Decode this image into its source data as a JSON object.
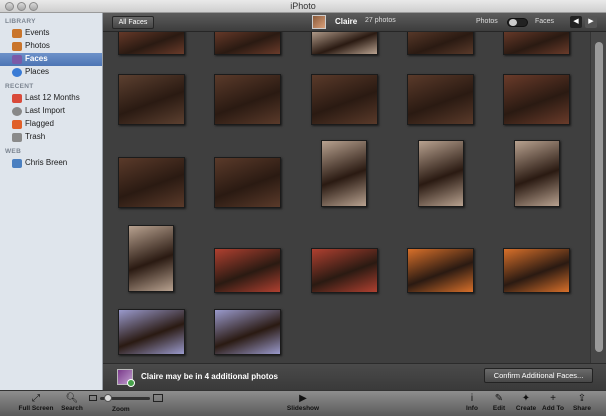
{
  "window": {
    "title": "iPhoto"
  },
  "sidebar": {
    "sections": [
      {
        "heading": "LIBRARY",
        "items": [
          {
            "label": "Events",
            "icon": "events-icon",
            "color": "#c9742a"
          },
          {
            "label": "Photos",
            "icon": "photos-icon",
            "color": "#c9742a"
          },
          {
            "label": "Faces",
            "icon": "faces-icon",
            "color": "#7b5aa8",
            "selected": true
          },
          {
            "label": "Places",
            "icon": "places-icon",
            "color": "#3a7bd5"
          }
        ]
      },
      {
        "heading": "RECENT",
        "items": [
          {
            "label": "Last 12 Months",
            "icon": "calendar-icon",
            "color": "#d94a3a"
          },
          {
            "label": "Last Import",
            "icon": "clock-icon",
            "color": "#888888"
          },
          {
            "label": "Flagged",
            "icon": "flag-icon",
            "color": "#e0602a"
          },
          {
            "label": "Trash",
            "icon": "trash-icon",
            "color": "#8a8a8a"
          }
        ]
      },
      {
        "heading": "WEB",
        "items": [
          {
            "label": "Chris Breen",
            "icon": "web-album-icon",
            "color": "#4a7fc0"
          }
        ]
      }
    ]
  },
  "header": {
    "all_faces_button": "All Faces",
    "face_name": "Claire",
    "photo_count": "27 photos",
    "toggle_left_label": "Photos",
    "toggle_right_label": "Faces",
    "back_glyph": "◀",
    "forward_glyph": "▶"
  },
  "infobar": {
    "message": "Claire may be in 4 additional photos",
    "confirm_button": "Confirm Additional Faces..."
  },
  "toolbar": {
    "buttons_left": [
      {
        "label": "Full Screen",
        "glyph": "⤢",
        "icon": "full-screen-icon"
      },
      {
        "label": "Search",
        "glyph": "🔍︎",
        "icon": "search-icon"
      }
    ],
    "zoom_label": "Zoom",
    "slideshow_label": "Slideshow",
    "slideshow_glyph": "▶",
    "buttons_right": [
      {
        "label": "Info",
        "glyph": "i",
        "icon": "info-icon"
      },
      {
        "label": "Edit",
        "glyph": "✎",
        "icon": "edit-icon"
      },
      {
        "label": "Create",
        "glyph": "✦",
        "icon": "create-icon"
      },
      {
        "label": "Add To",
        "glyph": "+",
        "icon": "add-to-icon"
      },
      {
        "label": "Share",
        "glyph": "⇪",
        "icon": "share-icon"
      }
    ]
  },
  "photos": [
    {
      "tone": "#6a3b2a"
    },
    {
      "tone": "#6a3b2a"
    },
    {
      "tone": "#b8a290"
    },
    {
      "tone": "#5a3a2a"
    },
    {
      "tone": "#6a3b2a"
    },
    {
      "tone": "#5c4030"
    },
    {
      "tone": "#5a3a2a"
    },
    {
      "tone": "#5a3a2a"
    },
    {
      "tone": "#5a3a2a"
    },
    {
      "tone": "#6a3b2a"
    },
    {
      "tone": "#5a3a2a"
    },
    {
      "tone": "#5a3a2a"
    },
    {
      "tone": "#b8a290"
    },
    {
      "tone": "#b8a290"
    },
    {
      "tone": "#b8a290"
    },
    {
      "tone": "#b8a290"
    },
    {
      "tone": "#b04030"
    },
    {
      "tone": "#b04030"
    },
    {
      "tone": "#d8702a"
    },
    {
      "tone": "#d8702a"
    },
    {
      "tone": "#9a9acc"
    },
    {
      "tone": "#9a9acc"
    }
  ]
}
